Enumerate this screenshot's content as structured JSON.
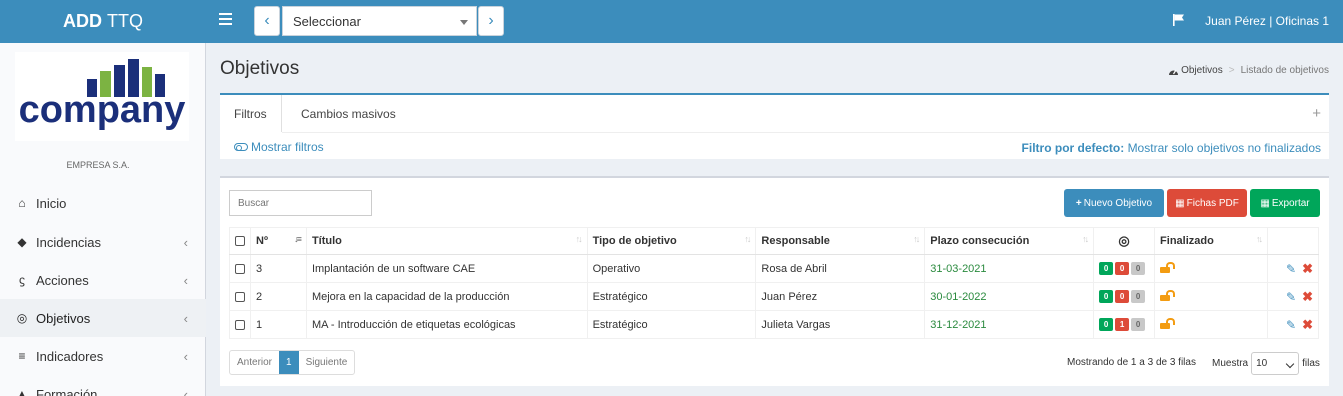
{
  "topbar": {
    "brand_bold": "ADD",
    "brand_rest": "TTQ",
    "prev_icon": "chevron-left-icon",
    "next_icon": "chevron-right-icon",
    "select_value": "Seleccionar",
    "user": "Juan Pérez | Oficinas 1",
    "colors": {
      "primary": "#3c8dbc"
    }
  },
  "sidebar": {
    "logo_text": "company",
    "company_name": "EMPRESA S.A.",
    "items": [
      {
        "label": "Inicio",
        "icon": "home-icon"
      },
      {
        "label": "Incidencias",
        "icon": "bell-icon"
      },
      {
        "label": "Acciones",
        "icon": "bolt-icon"
      },
      {
        "label": "Objetivos",
        "icon": "target-icon"
      },
      {
        "label": "Indicadores",
        "icon": "sliders-icon"
      },
      {
        "label": "Formación",
        "icon": "graduation-icon"
      }
    ]
  },
  "page": {
    "title": "Objetivos",
    "breadcrumb": [
      "Objetivos",
      "Listado de objetivos"
    ]
  },
  "filters": {
    "tabs": [
      "Filtros",
      "Cambios masivos"
    ],
    "show_filters": "Mostrar filtros",
    "default_label": "Filtro por defecto:",
    "default_value": "Mostrar solo objetivos no finalizados"
  },
  "table": {
    "search_placeholder": "Buscar",
    "buttons": {
      "new": "Nuevo Objetivo",
      "pdf": "Fichas PDF",
      "export": "Exportar"
    },
    "button_colors": {
      "new": "#3c8dbc",
      "pdf": "#dd4b39",
      "export": "#00a65a"
    },
    "columns": [
      "Nº",
      "Título",
      "Tipo de objetivo",
      "Responsable",
      "Plazo consecución",
      "Finalizado"
    ],
    "rows": [
      {
        "num": "3",
        "title": "Implantación de un software CAE",
        "type": "Operativo",
        "owner": "Rosa de Abril",
        "date": "31-03-2021",
        "badges": [
          "0",
          "0",
          "0"
        ]
      },
      {
        "num": "2",
        "title": "Mejora en la capacidad de la producción",
        "type": "Estratégico",
        "owner": "Juan Pérez",
        "date": "30-01-2022",
        "badges": [
          "0",
          "0",
          "0"
        ]
      },
      {
        "num": "1",
        "title": "MA - Introducción de etiquetas ecológicas",
        "type": "Estratégico",
        "owner": "Julieta Vargas",
        "date": "31-12-2021",
        "badges": [
          "0",
          "1",
          "0"
        ]
      }
    ],
    "pager": {
      "prev": "Anterior",
      "page": "1",
      "next": "Siguiente"
    },
    "info": "Mostrando de 1 a 3 de 3 filas",
    "length_prefix": "Muestra",
    "length_value": "10",
    "length_suffix": "filas"
  }
}
